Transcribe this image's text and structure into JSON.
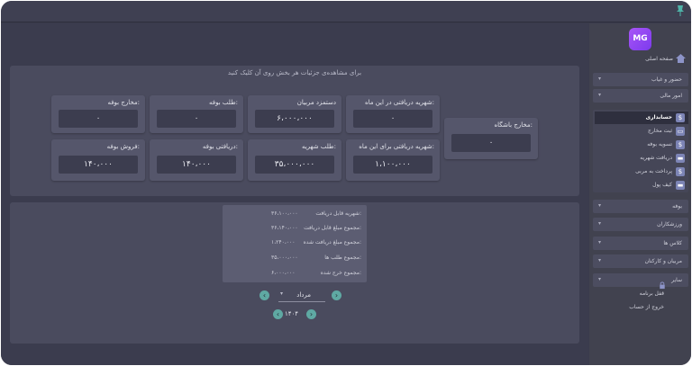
{
  "main": {
    "hint": "برای مشاهده‌ی جزئیات هر بخش روی آن کلیک کنید",
    "cards": {
      "gym_expenses": {
        "label": "مخارج باشگاه:",
        "value": "۰"
      },
      "tuition_this_month": {
        "label": "شهریه دریافتی در این ماه:",
        "value": "۰"
      },
      "trainer_wages": {
        "label": "دستمزد مربیان",
        "value": "۶،۰۰۰،۰۰۰"
      },
      "buffet_debt": {
        "label": "طلب بوفه:",
        "value": "۰"
      },
      "buffet_expenses": {
        "label": "مخارج بوفه:",
        "value": "۰"
      },
      "tuition_for_month": {
        "label": "شهریه دریافتی برای این ماه:",
        "value": "۱،۱۰۰،۰۰۰"
      },
      "tuition_debt": {
        "label": "طلب شهریه:",
        "value": "۳۵،۰۰۰،۰۰۰"
      },
      "buffet_received": {
        "label": "دریافتی بوفه:",
        "value": "۱۴۰،۰۰۰"
      },
      "buffet_sales": {
        "label": "فروش بوفه:",
        "value": "۱۴۰،۰۰۰"
      }
    },
    "summary": [
      {
        "key": "شهریه قابل دریافت:",
        "value": "۳۶،۱۰۰،۰۰۰"
      },
      {
        "key": "مجموع مبلغ قابل دریافت:",
        "value": "۳۶،۱۴۰،۰۰۰"
      },
      {
        "key": "مجموع مبلغ دریافت شده:",
        "value": "۱،۲۴۰،۰۰۰"
      },
      {
        "key": "مجموع طلب ها:",
        "value": "۳۵،۰۰۰،۰۰۰"
      },
      {
        "key": "مجموع خرج شده:",
        "value": "۶،۰۰۰،۰۰۰"
      }
    ],
    "month": "مرداد",
    "year": "۱۴۰۴"
  },
  "sidebar": {
    "logo": "MG",
    "home": "صفحه اصلی",
    "items": {
      "attendance": "حضور و غیاب",
      "finance": "امور مالی",
      "buffet": "بوفه",
      "athletes": "ورزشکاران",
      "classes": "کلاس ها",
      "trainers": "مربیان و کارکنان",
      "other": "سایر"
    },
    "finance_sub": {
      "accounting": "حسابداری",
      "record_expenses": "ثبت مخارج",
      "buffet_settlement": "تسویه بوفه",
      "receive_tuition": "دریافت شهریه",
      "pay_trainer": "پرداخت به مربی",
      "wallet": "کیف پول"
    },
    "lock": "قفل برنامه",
    "logout": "خروج از حساب"
  },
  "colors": {
    "background": "#3b3c4e",
    "panel": "#4a4b5e",
    "card": "#55566b",
    "accent": "#5fa9a3",
    "logo": "#8b5cf6"
  }
}
